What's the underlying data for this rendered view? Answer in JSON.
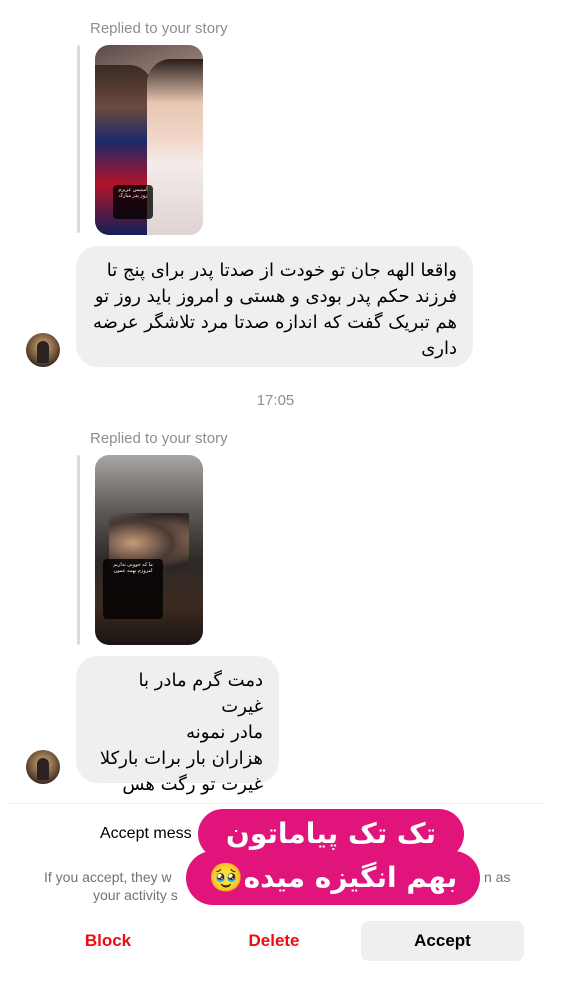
{
  "story_replies": [
    {
      "replied_label": "Replied to your story",
      "story_caption": "آمیتیس عزیزم روز پدر مبارک",
      "message": "واقعا الهه جان تو خودت از صدتا پدر برای پنج تا فرزند حکم پدر بودی و هستی و امروز باید روز تو هم تبریک گفت که اندازه صدتا مرد تلاشگر عرضه داری"
    },
    {
      "replied_label": "Replied to your story",
      "story_caption": "ما که جوونی نداریم امروزم بهمه عمون",
      "message": "دمت گرم مادر با غیرت\nمادر نمونه\nهزاران بار برات بارکلا\nغیرت تو رگت هس"
    }
  ],
  "timestamp": "17:05",
  "request": {
    "accept_prompt": "Accept mess",
    "info_line1": "If you accept, they w",
    "info_line1_end": "n as",
    "info_line2": "your activity s"
  },
  "actions": {
    "block": "Block",
    "delete": "Delete",
    "accept": "Accept"
  },
  "sticker": {
    "line1": "تک تک پیاماتون",
    "line2": "بهم انگیزه میده",
    "emoji": "🥹"
  },
  "colors": {
    "destructive": "#ed0c12",
    "bubble": "#efefef",
    "sticker": "#e0147a",
    "secondary_text": "#8e8e8e"
  }
}
